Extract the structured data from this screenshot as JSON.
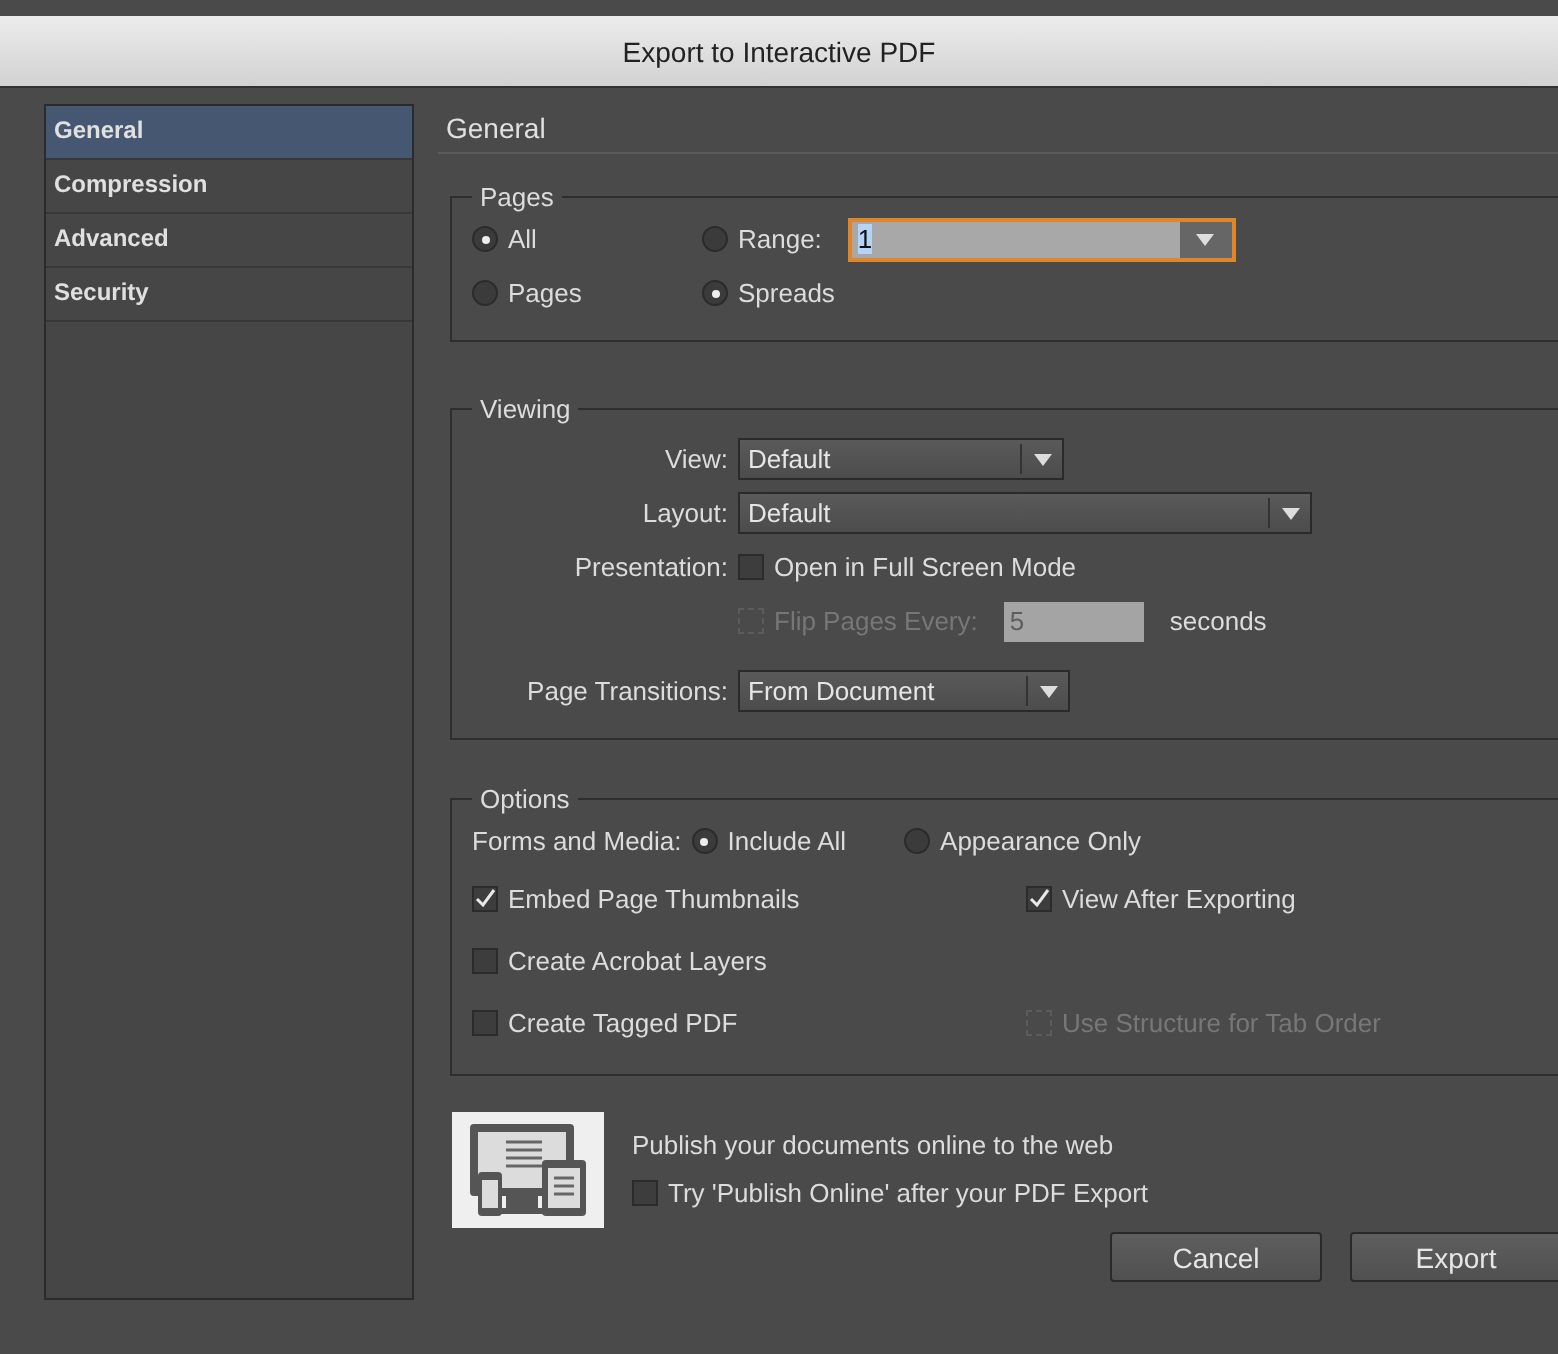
{
  "window": {
    "title": "Export to Interactive PDF"
  },
  "sidebar": {
    "items": [
      {
        "label": "General",
        "selected": true
      },
      {
        "label": "Compression",
        "selected": false
      },
      {
        "label": "Advanced",
        "selected": false
      },
      {
        "label": "Security",
        "selected": false
      }
    ]
  },
  "section_title": "General",
  "pages": {
    "title": "Pages",
    "radios": [
      {
        "label": "All",
        "selected": true
      },
      {
        "label": "Range:",
        "selected": false,
        "field": {
          "value": "1",
          "focused": true
        }
      },
      {
        "label": "Pages",
        "selected": false
      },
      {
        "label": "Spreads",
        "selected": true
      }
    ]
  },
  "viewing": {
    "title": "Viewing",
    "view": {
      "label": "View:",
      "value": "Default"
    },
    "layout": {
      "label": "Layout:",
      "value": "Default"
    },
    "presentation": {
      "label": "Presentation:",
      "checkbox": {
        "label": "Open in Full Screen Mode",
        "checked": false,
        "disabled": false
      }
    },
    "flip": {
      "checkbox": {
        "label": "Flip Pages Every:",
        "checked": false,
        "disabled": true
      },
      "value": "5",
      "unit": "seconds"
    },
    "transitions": {
      "label": "Page Transitions:",
      "value": "From Document"
    }
  },
  "options": {
    "title": "Options",
    "forms_label": "Forms and Media:",
    "forms_radios": [
      {
        "label": "Include All",
        "selected": true
      },
      {
        "label": "Appearance Only",
        "selected": false
      }
    ],
    "checkboxes": [
      {
        "label": "Embed Page Thumbnails",
        "checked": true,
        "disabled": false
      },
      {
        "label": "View After Exporting",
        "checked": true,
        "disabled": false
      },
      {
        "label": "Create Acrobat Layers",
        "checked": false,
        "disabled": false
      },
      {
        "label": "Create Tagged PDF",
        "checked": false,
        "disabled": false
      },
      {
        "label": "Use Structure for Tab Order",
        "checked": false,
        "disabled": true
      }
    ]
  },
  "publish": {
    "text": "Publish your documents online to the web",
    "checkbox": {
      "label": "Try 'Publish Online' after your PDF Export",
      "checked": false,
      "disabled": false
    }
  },
  "buttons": [
    "Cancel",
    "Export"
  ]
}
